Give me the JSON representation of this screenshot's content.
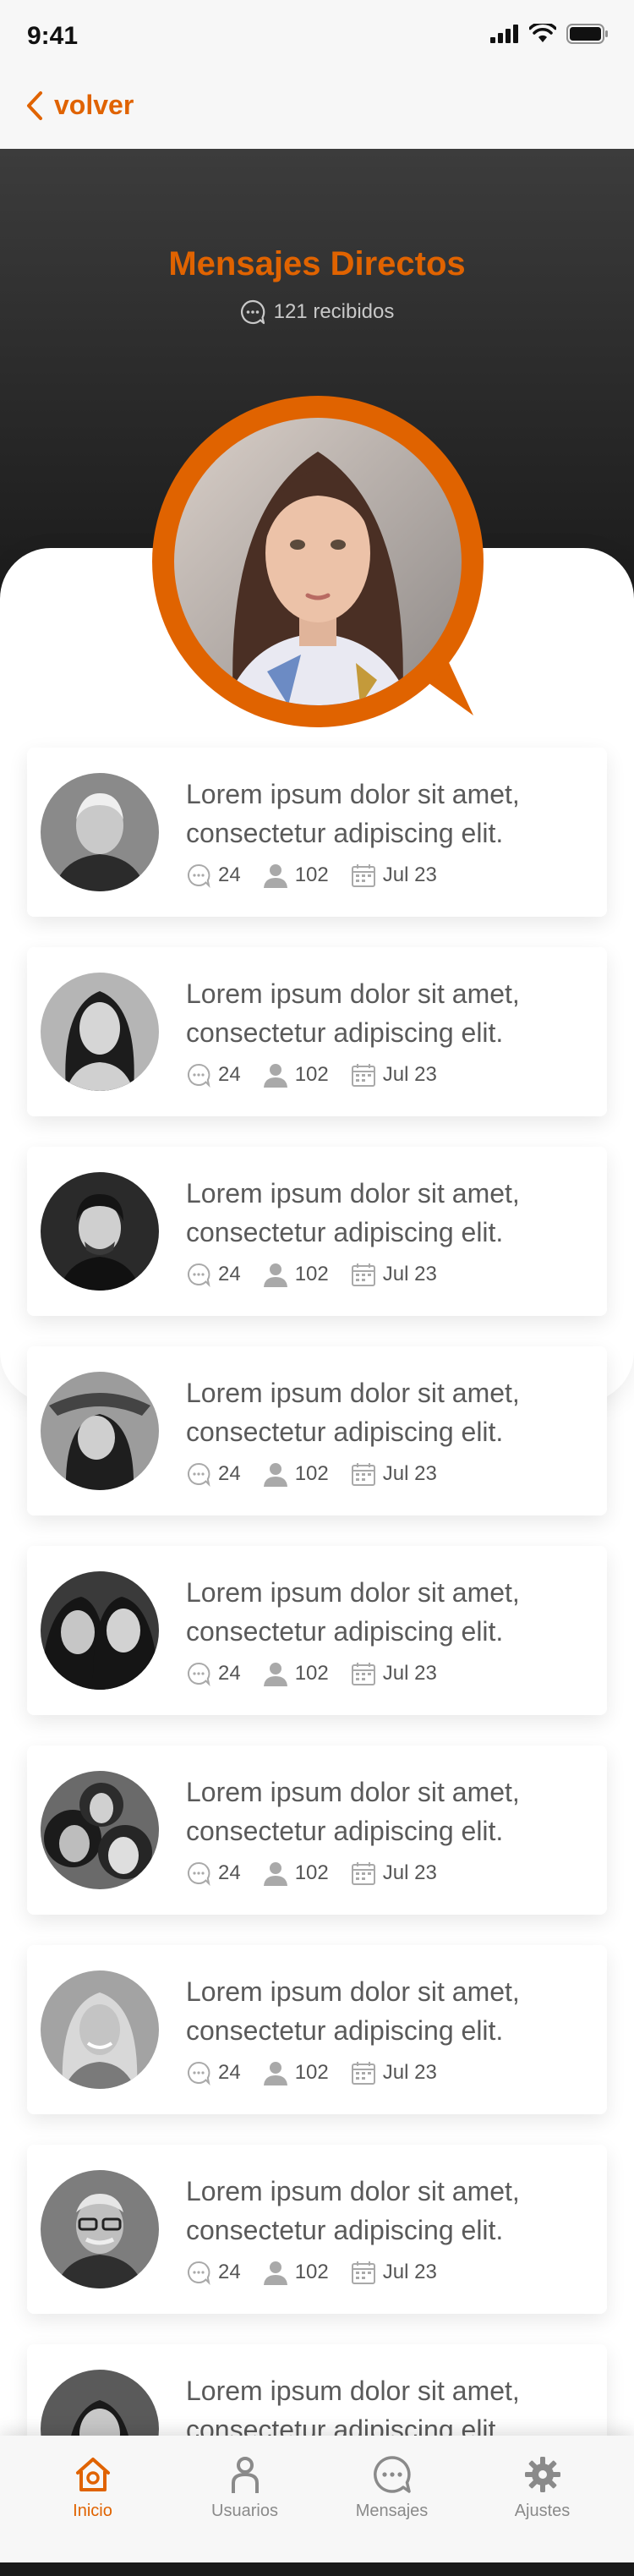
{
  "status_bar": {
    "time": "9:41"
  },
  "nav": {
    "back_label": "volver"
  },
  "header": {
    "title": "Mensajes Directos",
    "received": "121 recibidos"
  },
  "messages": [
    {
      "text": "Lorem ipsum dolor sit amet, consectetur adipiscing elit.",
      "comments": "24",
      "users": "102",
      "date": "Jul 23",
      "avatar": "elderly-man"
    },
    {
      "text": "Lorem ipsum dolor sit amet, consectetur adipiscing elit.",
      "comments": "24",
      "users": "102",
      "date": "Jul 23",
      "avatar": "young-woman"
    },
    {
      "text": "Lorem ipsum dolor sit amet, consectetur adipiscing elit.",
      "comments": "24",
      "users": "102",
      "date": "Jul 23",
      "avatar": "young-man"
    },
    {
      "text": "Lorem ipsum dolor sit amet, consectetur adipiscing elit.",
      "comments": "24",
      "users": "102",
      "date": "Jul 23",
      "avatar": "woman-hat"
    },
    {
      "text": "Lorem ipsum dolor sit amet, consectetur adipiscing elit.",
      "comments": "24",
      "users": "102",
      "date": "Jul 23",
      "avatar": "two-women"
    },
    {
      "text": "Lorem ipsum dolor sit amet, consectetur adipiscing elit.",
      "comments": "24",
      "users": "102",
      "date": "Jul 23",
      "avatar": "group-selfie"
    },
    {
      "text": "Lorem ipsum dolor sit amet, consectetur adipiscing elit.",
      "comments": "24",
      "users": "102",
      "date": "Jul 23",
      "avatar": "blonde-woman"
    },
    {
      "text": "Lorem ipsum dolor sit amet, consectetur adipiscing elit.",
      "comments": "24",
      "users": "102",
      "date": "Jul 23",
      "avatar": "man-glasses"
    },
    {
      "text": "Lorem ipsum dolor sit amet, consectetur adipiscing elit.",
      "comments": "",
      "users": "",
      "date": "",
      "avatar": "partial"
    }
  ],
  "tabs": [
    {
      "label": "Inicio",
      "icon": "home-icon",
      "active": true
    },
    {
      "label": "Usuarios",
      "icon": "user-icon",
      "active": false
    },
    {
      "label": "Mensajes",
      "icon": "chat-icon",
      "active": false
    },
    {
      "label": "Ajustes",
      "icon": "settings-icon",
      "active": false
    }
  ],
  "colors": {
    "accent": "#e06300",
    "hero_dark": "#191919",
    "text": "#5a5a5a",
    "icon_gray": "#9a9a9a"
  }
}
